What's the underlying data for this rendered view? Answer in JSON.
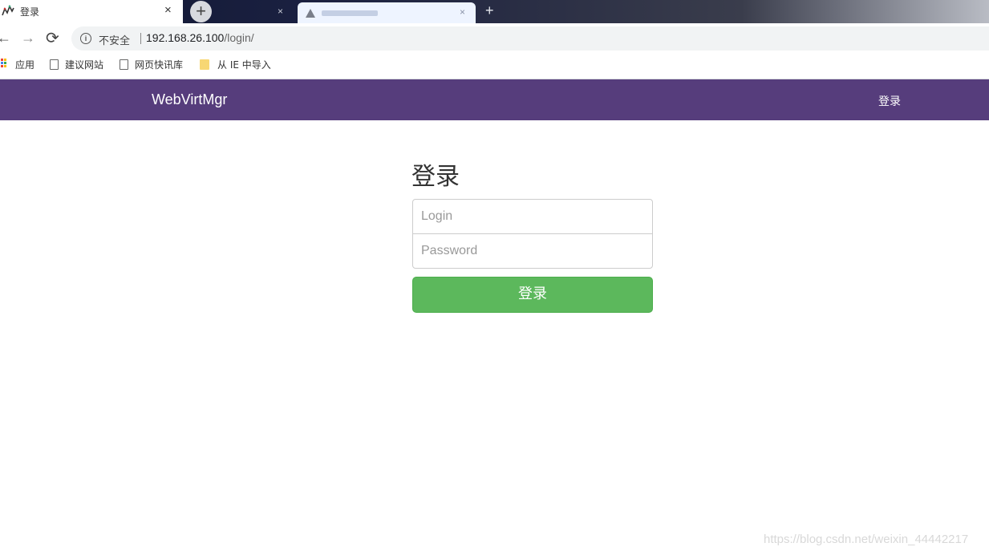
{
  "browser": {
    "active_tab_title": "登录",
    "active_tab_close": "×",
    "new_tab_symbol": "+",
    "second_tab_close": "×",
    "hidden_tab_close": "×",
    "tab_plus": "+",
    "nav_back": "←",
    "nav_forward": "→",
    "nav_reload": "⟳",
    "security_label": "不安全",
    "url_host": "192.168.26.100",
    "url_path": "/login/"
  },
  "bookmarks": [
    {
      "label": "应用",
      "icon": "apps-grid-icon"
    },
    {
      "label": "建议网站",
      "icon": "page-icon"
    },
    {
      "label": "网页快讯库",
      "icon": "page-icon"
    },
    {
      "label": "从 IE 中导入",
      "icon": "folder-icon"
    }
  ],
  "navbar": {
    "brand": "WebVirtMgr",
    "login_link": "登录",
    "bg_color": "#563d7c"
  },
  "form": {
    "title": "登录",
    "login_placeholder": "Login",
    "password_placeholder": "Password",
    "submit_label": "登录",
    "submit_color": "#5cb85c"
  },
  "watermark": "https://blog.csdn.net/weixin_44442217"
}
